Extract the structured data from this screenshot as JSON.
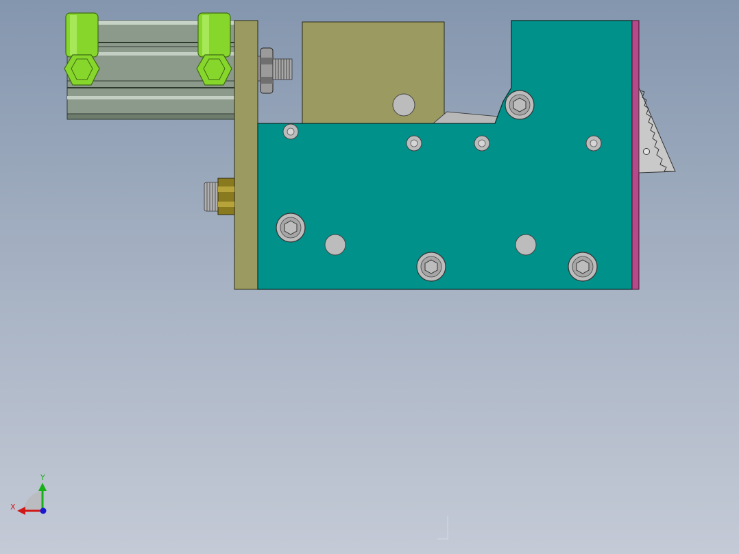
{
  "app": {
    "view": "front-view"
  },
  "triad": {
    "x_label": "X",
    "y_label": "Y"
  },
  "colors": {
    "background_top": "#8496ae",
    "background_bottom": "#c4cad6",
    "main_plate": "#00918a",
    "upright_plate": "#9a9a61",
    "block": "#9a9a61",
    "cylinder_body": "#8c9a8c",
    "fitting_green": "#86d62c",
    "side_strip": "#b54a8a",
    "bolt_gray": "#b8b8b8",
    "blade_gray": "#c9c9c9",
    "brass_nut": "#8a7a1f",
    "axis_x": "#d01818",
    "axis_y": "#18b018",
    "axis_z": "#1818d0"
  }
}
